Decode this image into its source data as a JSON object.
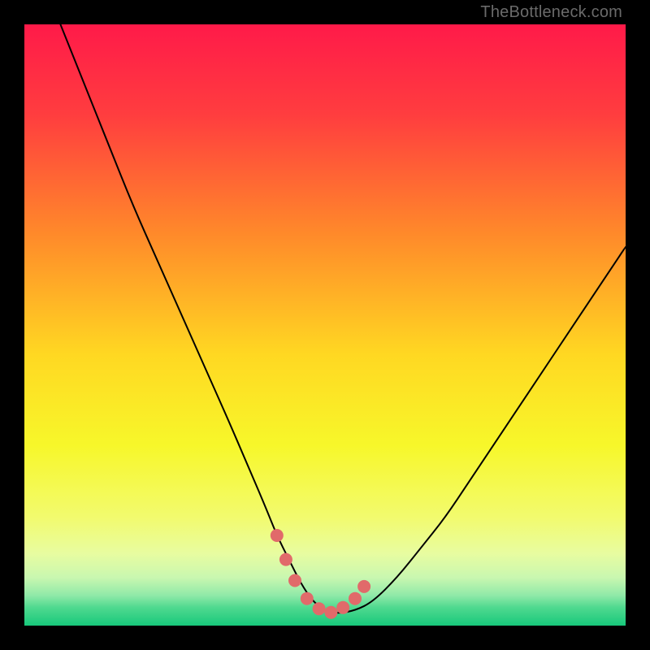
{
  "watermark": "TheBottleneck.com",
  "gradient_stops": [
    {
      "pct": 0,
      "color": "#ff1a49"
    },
    {
      "pct": 15,
      "color": "#ff3d3f"
    },
    {
      "pct": 35,
      "color": "#ff8a2a"
    },
    {
      "pct": 55,
      "color": "#ffd822"
    },
    {
      "pct": 70,
      "color": "#f7f72a"
    },
    {
      "pct": 82,
      "color": "#f2fb6e"
    },
    {
      "pct": 88,
      "color": "#e8fca0"
    },
    {
      "pct": 92,
      "color": "#c9f7b0"
    },
    {
      "pct": 95,
      "color": "#8fe9a8"
    },
    {
      "pct": 97,
      "color": "#4fd98f"
    },
    {
      "pct": 100,
      "color": "#17c87b"
    }
  ],
  "marker_color": "#e16a6a",
  "curve_color": "#000000",
  "chart_data": {
    "type": "line",
    "title": "",
    "xlabel": "",
    "ylabel": "",
    "xlim": [
      0,
      100
    ],
    "ylim": [
      0,
      100
    ],
    "grid": false,
    "legend": false,
    "series": [
      {
        "name": "curve",
        "x": [
          6,
          10,
          14,
          18,
          22,
          26,
          30,
          34,
          37,
          40,
          42,
          44,
          46,
          48,
          50,
          52,
          55,
          58,
          62,
          66,
          70,
          74,
          78,
          82,
          86,
          90,
          94,
          98,
          100
        ],
        "y": [
          100,
          90,
          80,
          70,
          61,
          52,
          43,
          34,
          27,
          20,
          15,
          11,
          7,
          4,
          2.5,
          2,
          2.5,
          4,
          8,
          13,
          18,
          24,
          30,
          36,
          42,
          48,
          54,
          60,
          63
        ]
      }
    ],
    "markers": {
      "name": "highlight-points",
      "x": [
        42,
        43.5,
        45,
        47,
        49,
        51,
        53,
        55,
        56.5
      ],
      "y": [
        15,
        11,
        7.5,
        4.5,
        2.8,
        2.2,
        3,
        4.5,
        6.5
      ]
    }
  }
}
